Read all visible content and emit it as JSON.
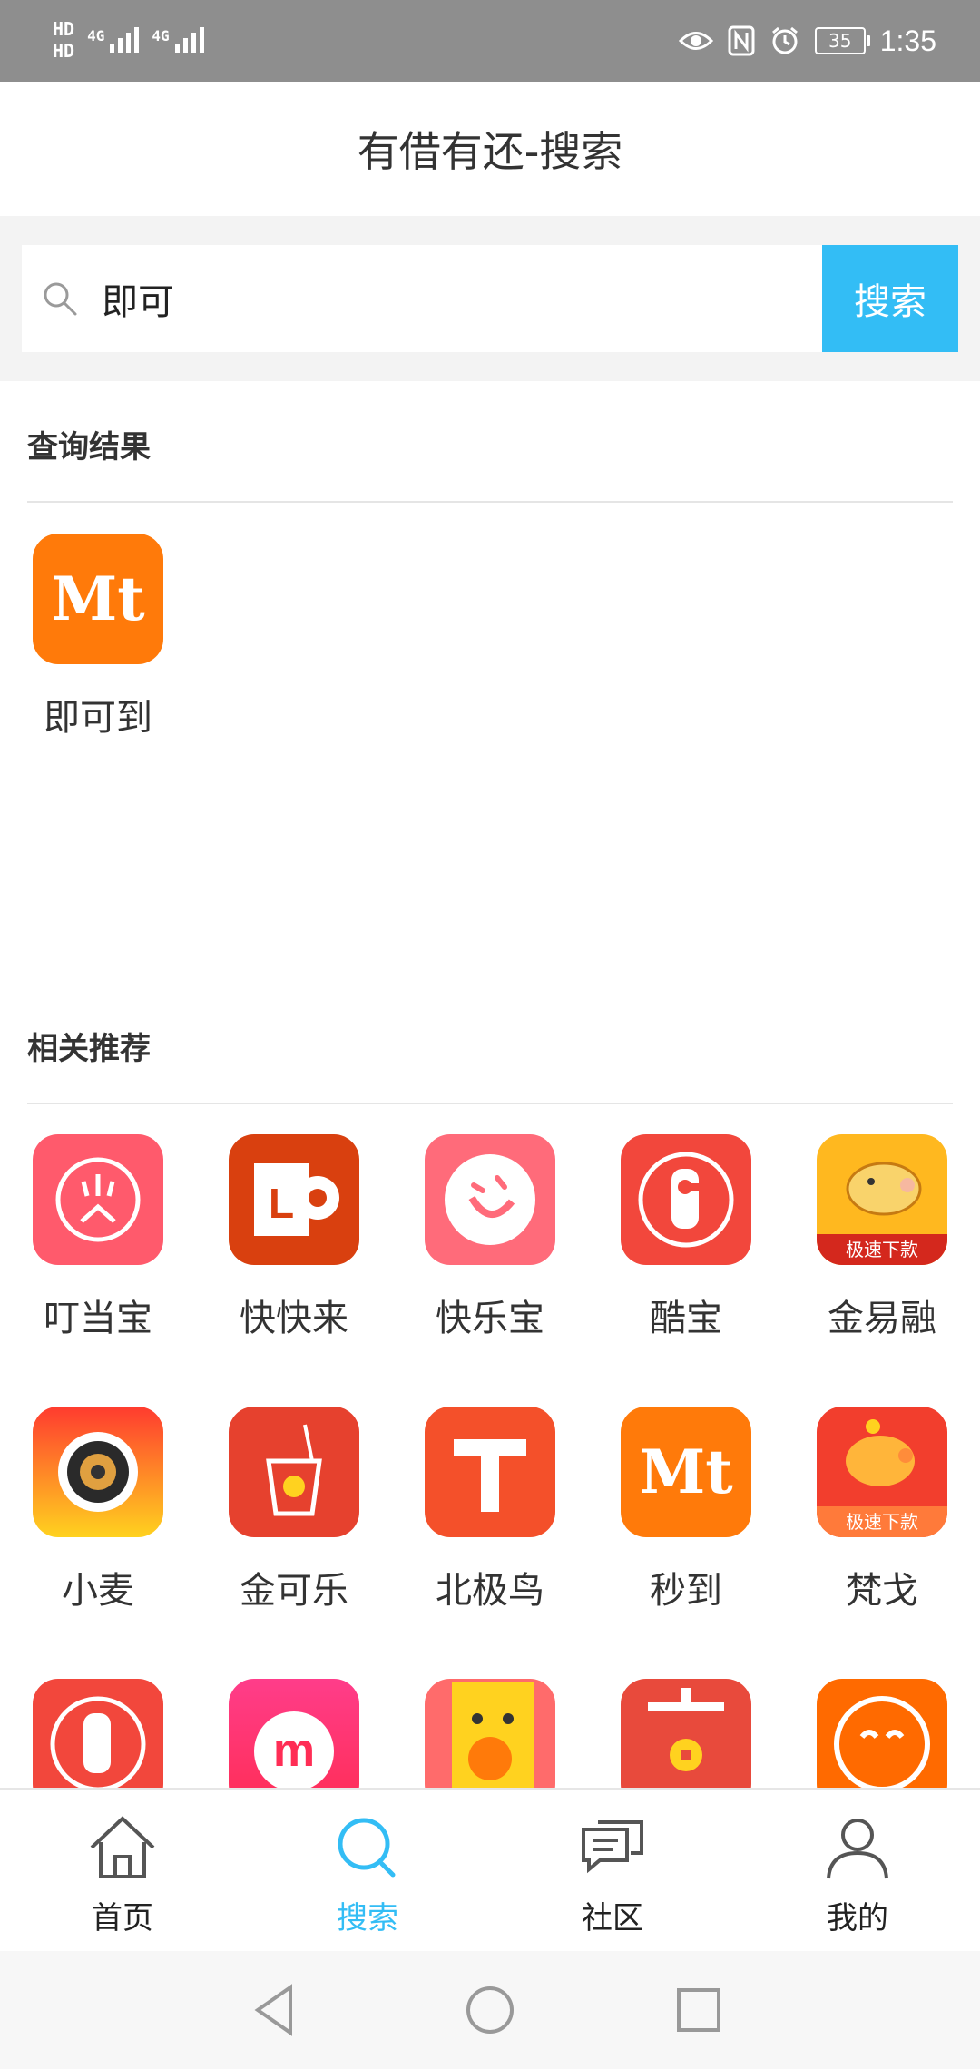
{
  "status_bar": {
    "hd_top": "HD",
    "hd_bottom": "HD",
    "signal1": "4G",
    "signal2": "4G",
    "battery": "35",
    "time": "1:35"
  },
  "header": {
    "title": "有借有还-搜索"
  },
  "search": {
    "value": "即可",
    "button_label": "搜索"
  },
  "results": {
    "title": "查询结果",
    "items": [
      {
        "label": "即可到",
        "icon": "mt-logo-icon"
      }
    ]
  },
  "recommend": {
    "title": "相关推荐",
    "items": [
      {
        "label": "叮当宝",
        "icon": "dingdangbao-icon"
      },
      {
        "label": "快快来",
        "icon": "kuaikuailai-icon"
      },
      {
        "label": "快乐宝",
        "icon": "kuailebao-icon"
      },
      {
        "label": "酷宝",
        "icon": "kubao-icon"
      },
      {
        "label": "金易融",
        "icon": "pig-icon",
        "badge": "极速下款"
      },
      {
        "label": "小麦",
        "icon": "camera-lens-icon"
      },
      {
        "label": "金可乐",
        "icon": "cola-cup-icon"
      },
      {
        "label": "北极鸟",
        "icon": "t-logo-icon"
      },
      {
        "label": "秒到",
        "icon": "mt-logo-icon"
      },
      {
        "label": "梵戈",
        "icon": "piggy-bank-icon",
        "badge": "极速下款"
      },
      {
        "label": "",
        "icon": "door-hanger-icon"
      },
      {
        "label": "",
        "icon": "m-logo-icon"
      },
      {
        "label": "",
        "icon": "chick-icon"
      },
      {
        "label": "",
        "icon": "an-coin-icon"
      },
      {
        "label": "",
        "icon": "smile-face-icon"
      }
    ]
  },
  "tabs": [
    {
      "label": "首页",
      "icon": "home-icon"
    },
    {
      "label": "搜索",
      "icon": "search-icon",
      "active": true
    },
    {
      "label": "社区",
      "icon": "chat-icon"
    },
    {
      "label": "我的",
      "icon": "user-icon"
    }
  ],
  "colors": {
    "accent": "#33bdf5",
    "status_bar": "#8e8e8e"
  }
}
